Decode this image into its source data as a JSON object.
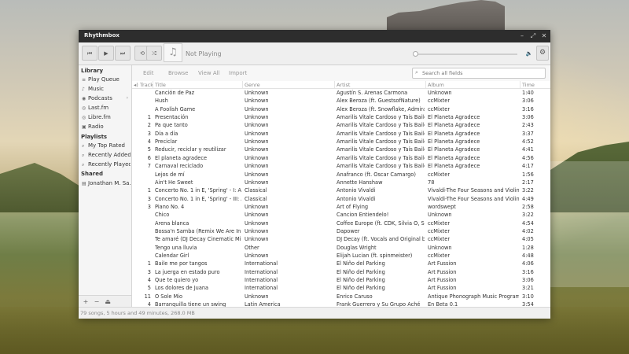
{
  "window": {
    "title": "Rhythmbox"
  },
  "toolbar": {
    "now_playing": "Not Playing"
  },
  "sidebar": {
    "library_header": "Library",
    "library_items": [
      {
        "label": "Play Queue",
        "icon": "queue-icon"
      },
      {
        "label": "Music",
        "icon": "music-icon"
      },
      {
        "label": "Podcasts",
        "icon": "podcast-icon"
      },
      {
        "label": "Last.fm",
        "icon": "lastfm-icon"
      },
      {
        "label": "Libre.fm",
        "icon": "librefm-icon"
      },
      {
        "label": "Radio",
        "icon": "radio-icon"
      }
    ],
    "playlists_header": "Playlists",
    "playlist_items": [
      {
        "label": "My Top Rated"
      },
      {
        "label": "Recently Added"
      },
      {
        "label": "Recently Played"
      }
    ],
    "shared_header": "Shared",
    "shared_items": [
      {
        "label": "Jonathan M. Sa..."
      }
    ]
  },
  "browse_bar": {
    "edit": "Edit",
    "browse": "Browse",
    "view_all": "View All",
    "import": "Import",
    "search_placeholder": "Search all fields"
  },
  "columns": {
    "track": "Track",
    "title": "Title",
    "genre": "Genre",
    "artist": "Artist",
    "album": "Album",
    "time": "Time"
  },
  "tracks": [
    {
      "track": "",
      "title": "Canción de Paz",
      "genre": "Unknown",
      "artist": "Agustín S. Arenas Carmona",
      "album": "Unknown",
      "time": "1:40"
    },
    {
      "track": "",
      "title": "Hush",
      "genre": "Unknown",
      "artist": "Alex Beroza (ft. GuestsofNature)",
      "album": "ccMixter",
      "time": "3:06"
    },
    {
      "track": "",
      "title": "A Foolish Game",
      "genre": "Unknown",
      "artist": "Alex Beroza (ft. Snowflake, Admiral B...",
      "album": "ccMixter",
      "time": "3:16"
    },
    {
      "track": "1",
      "title": "Presentación",
      "genre": "Unknown",
      "artist": "Amarilis Vitale Cardoso y Taís Baileiro",
      "album": "El Planeta Agradece",
      "time": "3:06"
    },
    {
      "track": "2",
      "title": "Pa que tanto",
      "genre": "Unknown",
      "artist": "Amarilis Vitale Cardoso y Taís Baileiro",
      "album": "El Planeta Agradece",
      "time": "2:43"
    },
    {
      "track": "3",
      "title": "Día a día",
      "genre": "Unknown",
      "artist": "Amarilis Vitale Cardoso y Taís Baileiro",
      "album": "El Planeta Agradece",
      "time": "3:37"
    },
    {
      "track": "4",
      "title": "Preciclar",
      "genre": "Unknown",
      "artist": "Amarilis Vitale Cardoso y Taís Baileiro",
      "album": "El Planeta Agradece",
      "time": "4:52"
    },
    {
      "track": "5",
      "title": "Reducir, reciclar y reutilizar",
      "genre": "Unknown",
      "artist": "Amarilis Vitale Cardoso y Taís Baileiro",
      "album": "El Planeta Agradece",
      "time": "4:41"
    },
    {
      "track": "6",
      "title": "El planeta agradece",
      "genre": "Unknown",
      "artist": "Amarilis Vitale Cardoso y Taís Baileiro",
      "album": "El Planeta Agradece",
      "time": "4:56"
    },
    {
      "track": "7",
      "title": "Carnaval reciclado",
      "genre": "Unknown",
      "artist": "Amarilis Vitale Cardoso y Taís Baileiro",
      "album": "El Planeta Agradece",
      "time": "4:17"
    },
    {
      "track": "",
      "title": "Lejos de mí",
      "genre": "Unknown",
      "artist": "Anafranco (ft. Oscar Camargo)",
      "album": "ccMixter",
      "time": "1:56"
    },
    {
      "track": "",
      "title": "Ain't He Sweet",
      "genre": "Unknown",
      "artist": "Annette Hanshaw",
      "album": "78",
      "time": "2:17"
    },
    {
      "track": "1",
      "title": "Concerto No. 1 in E, 'Spring' - I: Alle...",
      "genre": "Classical",
      "artist": "Antonio Vivaldi",
      "album": "Vivaldi-The Four Seasons and Violin C...",
      "time": "3:22"
    },
    {
      "track": "3",
      "title": "Concerto No. 1 in E, 'Spring' - III: All...",
      "genre": "Classical",
      "artist": "Antonio Vivaldi",
      "album": "Vivaldi-The Four Seasons and Violin C...",
      "time": "4:49"
    },
    {
      "track": "3",
      "title": "Piano No. 4",
      "genre": "Unknown",
      "artist": "Art of Flying",
      "album": "wordswept",
      "time": "2:58"
    },
    {
      "track": "",
      "title": "Chico",
      "genre": "Unknown",
      "artist": "Cancion Entiendelo!",
      "album": "Unknown",
      "time": "3:22"
    },
    {
      "track": "",
      "title": "Arena blanca",
      "genre": "Unknown",
      "artist": "Coffee Europe (ft. CDK, Silvia O, SU...",
      "album": "ccMixter",
      "time": "4:54"
    },
    {
      "track": "",
      "title": "Bossa'n Samba (Remix We Are In Lo...",
      "genre": "Unknown",
      "artist": "Dapower",
      "album": "ccMixter",
      "time": "4:02"
    },
    {
      "track": "",
      "title": "Te amaré (DJ Decay Cinematic Mix)",
      "genre": "Unknown",
      "artist": "DJ Decay (ft. Vocals and Original by ...",
      "album": "ccMixter",
      "time": "4:05"
    },
    {
      "track": "",
      "title": "Tengo una lluvia",
      "genre": "Other",
      "artist": "Douglas Wright",
      "album": "Unknown",
      "time": "1:28"
    },
    {
      "track": "",
      "title": "Calendar Girl",
      "genre": "Unknown",
      "artist": "Elijah Lucian (ft. spinmeister)",
      "album": "ccMixter",
      "time": "4:48"
    },
    {
      "track": "1",
      "title": "Baile me por tangos",
      "genre": "International",
      "artist": "El Niño del Parking",
      "album": "Art Fussion",
      "time": "4:06"
    },
    {
      "track": "3",
      "title": "La juerga en estado puro",
      "genre": "International",
      "artist": "El Niño del Parking",
      "album": "Art Fussion",
      "time": "3:16"
    },
    {
      "track": "4",
      "title": "Que te quiero yo",
      "genre": "International",
      "artist": "El Niño del Parking",
      "album": "Art Fussion",
      "time": "3:06"
    },
    {
      "track": "5",
      "title": "Los dolores de Juana",
      "genre": "International",
      "artist": "El Niño del Parking",
      "album": "Art Fussion",
      "time": "3:21"
    },
    {
      "track": "11",
      "title": "O Sole Mio",
      "genre": "Unknown",
      "artist": "Enrico Caruso",
      "album": "Antique Phonograph Music Program ...",
      "time": "3:10"
    },
    {
      "track": "4",
      "title": "Barranquilla tiene un swing",
      "genre": "Latin America",
      "artist": "Frank Guerrero  y Su Grupo Aché",
      "album": "En Beta 0.1",
      "time": "3:54"
    }
  ],
  "status_text": "79 songs, 5 hours and 49 minutes, 268.0 MB"
}
